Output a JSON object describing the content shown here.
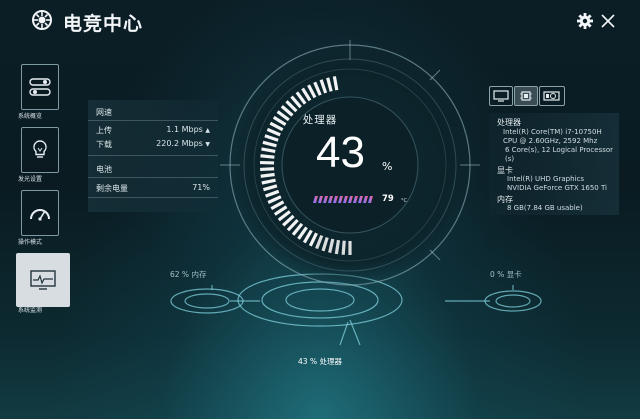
{
  "app": {
    "title": "电竞中心"
  },
  "sidebar": {
    "items": [
      {
        "label": "系统概览",
        "icon": "toggle-switches-icon"
      },
      {
        "label": "发光设置",
        "icon": "lightbulb-icon"
      },
      {
        "label": "操作模式",
        "icon": "speedometer-icon"
      },
      {
        "label": "系统监测",
        "icon": "monitor-pulse-icon",
        "active": true
      }
    ]
  },
  "network": {
    "heading": "网速",
    "upload_label": "上传",
    "upload_value": "1.1 Mbps",
    "download_label": "下载",
    "download_value": "220.2 Mbps"
  },
  "battery": {
    "heading": "电池",
    "remaining_label": "剩余电量",
    "remaining_value": "71%"
  },
  "gauge": {
    "title": "处理器",
    "value": "43",
    "unit": "%",
    "usage_fraction": 0.43,
    "temperature": "79",
    "temperature_unit": "°C"
  },
  "floor": {
    "memory_label": "62 % 内存",
    "gpu_label": "0 % 显卡",
    "cpu_label": "43 % 处理器"
  },
  "hardware": {
    "tabs": [
      "display-icon",
      "cpu-chip-icon",
      "gpu-card-icon"
    ],
    "cpu_heading": "处理器",
    "cpu_lines": [
      "Intel(R) Core(TM) i7-10750H",
      "CPU @ 2.60GHz, 2592 Mhz",
      "6 Core(s), 12 Logical Processor",
      "(s)"
    ],
    "gpu_heading": "显卡",
    "gpu_lines": [
      "Intel(R) UHD Graphics",
      "NVIDIA GeForce GTX 1650 Ti"
    ],
    "memory_heading": "内存",
    "memory_lines": [
      "8 GB(7.84 GB usable)"
    ]
  },
  "colors": {
    "accent_cyan": "#39c6d6",
    "gradient_start": "#4a6cff",
    "gradient_end": "#ff5a6e"
  }
}
